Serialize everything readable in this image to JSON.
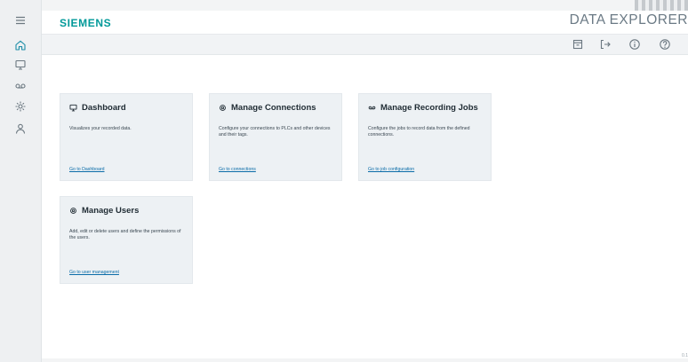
{
  "header": {
    "brand": "SIEMENS",
    "app_title": "DATA EXPLORER"
  },
  "sidebar": {
    "items": [
      {
        "name": "menu",
        "icon": "hamburger-menu-icon"
      },
      {
        "name": "home",
        "icon": "home-icon",
        "active": true
      },
      {
        "name": "dashboard",
        "icon": "monitor-icon"
      },
      {
        "name": "recording-jobs",
        "icon": "recording-icon"
      },
      {
        "name": "connections",
        "icon": "gear-icon"
      },
      {
        "name": "users",
        "icon": "user-icon"
      }
    ]
  },
  "toolbar": {
    "icons": [
      "archive-icon",
      "logout-icon",
      "info-icon",
      "help-icon"
    ]
  },
  "cards": [
    {
      "title": "Dashboard",
      "icon": "monitor-icon",
      "description": "Visualizes your recorded data.",
      "link": "Go to Dashboard"
    },
    {
      "title": "Manage Connections",
      "icon": "gear-icon",
      "description": "Configure your connections to PLCs and other devices and their tags.",
      "link": "Go to connections"
    },
    {
      "title": "Manage Recording Jobs",
      "icon": "recording-icon",
      "description": "Configure the jobs to record data from the defined connections.",
      "link": "Go to job configuration"
    },
    {
      "title": "Manage Users",
      "icon": "gear-icon",
      "description": "Add, edit or delete users and define the permissions of the users.",
      "link": "Go to user management"
    }
  ],
  "footer": {
    "version": "0.1"
  },
  "colors": {
    "brand": "#009999",
    "link": "#0a6ca8",
    "active_icon": "#1e8ea8",
    "card_bg": "#edf1f4"
  }
}
